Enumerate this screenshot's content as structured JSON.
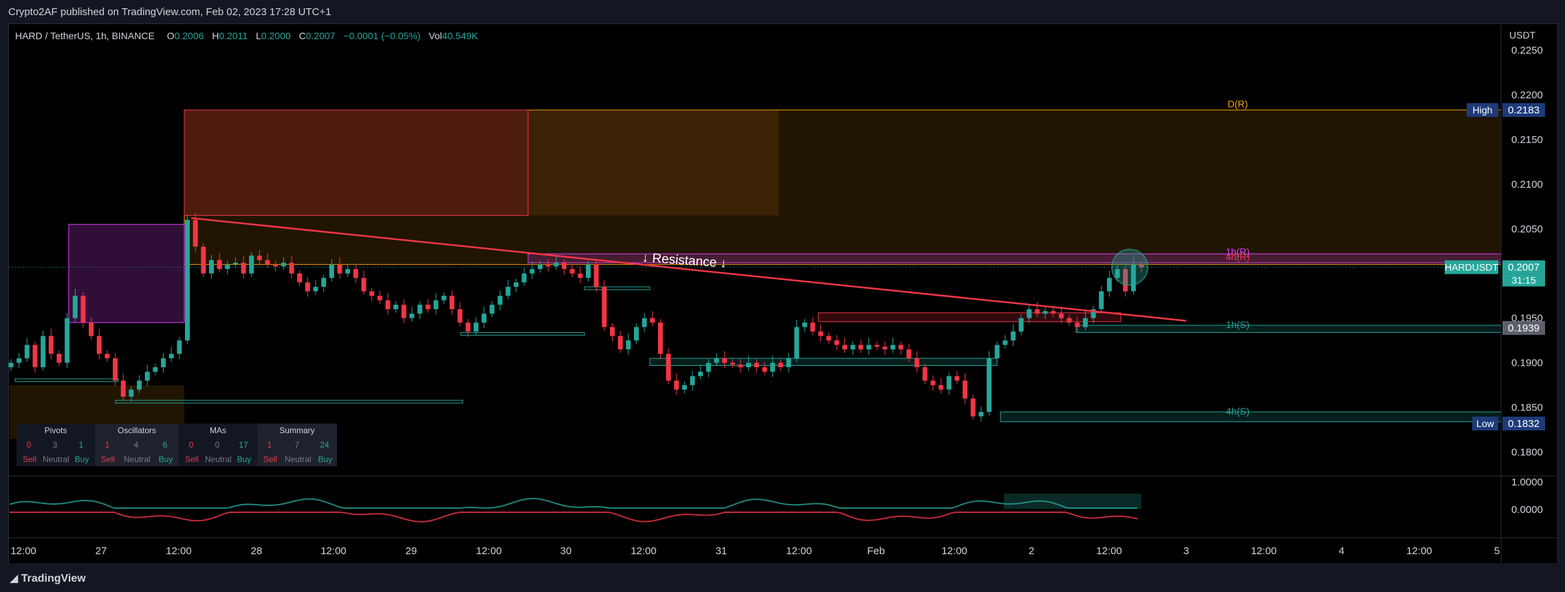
{
  "header": {
    "published": "Crypto2AF published on TradingView.com, Feb 02, 2023 17:28 UTC+1"
  },
  "legend": {
    "symbol": "HARD / TetherUS, 1h, BINANCE",
    "open_label": "O",
    "open": "0.2006",
    "high_label": "H",
    "high": "0.2011",
    "low_label": "L",
    "low": "0.2000",
    "close_label": "C",
    "close": "0.2007",
    "change": "−0.0001 (−0.05%)",
    "vol_label": "Vol",
    "vol": "40.549K"
  },
  "footer": {
    "brand": "TradingView"
  },
  "colors": {
    "up": "#26a69a",
    "down": "#f23645",
    "trendline": "#f23645",
    "zone_daily": "#f7a600",
    "zone_1h_r": "#e040fb",
    "support": "#26a69a"
  },
  "tech_summary": [
    {
      "title": "Pivots",
      "sell": "0",
      "neutral": "3",
      "buy": "1"
    },
    {
      "title": "Oscillators",
      "sell": "1",
      "neutral": "4",
      "buy": "6"
    },
    {
      "title": "MAs",
      "sell": "0",
      "neutral": "0",
      "buy": "17"
    },
    {
      "title": "Summary",
      "sell": "1",
      "neutral": "7",
      "buy": "24"
    }
  ],
  "tech_labels": {
    "sell": "Sell",
    "neutral": "Neutral",
    "buy": "Buy"
  },
  "chart_data": {
    "type": "candlestick",
    "title": "",
    "price_axis_unit": "USDT",
    "y_ticks": [
      "0.2250",
      "0.2200",
      "0.2150",
      "0.2100",
      "0.2050",
      "0.2000",
      "0.1950",
      "0.1900",
      "0.1850",
      "0.1800"
    ],
    "ylim": [
      0.1775,
      0.228
    ],
    "x_ticks": [
      "12:00",
      "27",
      "12:00",
      "28",
      "12:00",
      "29",
      "12:00",
      "30",
      "12:00",
      "31",
      "12:00",
      "Feb",
      "12:00",
      "2",
      "12:00",
      "3",
      "12:00",
      "4",
      "12:00",
      "5"
    ],
    "price_labels": [
      {
        "name": "High",
        "value": "0.2183"
      },
      {
        "name": "HARDUSDT",
        "value": "0.2007",
        "countdown": "31:15"
      },
      {
        "name": "",
        "value": "0.1939"
      },
      {
        "name": "Low",
        "value": "0.1832"
      }
    ],
    "zone_labels": {
      "daily_resistance": "D(R)",
      "h1_resistance": "1h(R)",
      "h4_resistance": "4h(R)",
      "h1_support": "1h(S)",
      "h4_support": "4h(S)"
    },
    "annotation": "↓ Resistance ↓",
    "zones": [
      {
        "label": "D(R)",
        "from": 0.2065,
        "to": 0.2183
      },
      {
        "label": "1h(R)",
        "from": 0.2012,
        "to": 0.2022
      },
      {
        "label": "1h(S)",
        "from": 0.1934,
        "to": 0.1942
      },
      {
        "label": "4h(S)",
        "from": 0.1834,
        "to": 0.1845
      }
    ],
    "series": [
      {
        "name": "HARDUSDT",
        "close": [
          0.19,
          0.1905,
          0.192,
          0.1895,
          0.193,
          0.191,
          0.19,
          0.195,
          0.1975,
          0.1945,
          0.193,
          0.191,
          0.1905,
          0.188,
          0.1862,
          0.187,
          0.188,
          0.189,
          0.1895,
          0.1905,
          0.191,
          0.1925,
          0.206,
          0.203,
          0.2,
          0.2015,
          0.2005,
          0.201,
          0.2012,
          0.2,
          0.202,
          0.2015,
          0.201,
          0.2008,
          0.2012,
          0.2,
          0.199,
          0.198,
          0.1985,
          0.1995,
          0.201,
          0.2,
          0.2005,
          0.1995,
          0.198,
          0.1975,
          0.197,
          0.196,
          0.1965,
          0.195,
          0.1955,
          0.1965,
          0.196,
          0.197,
          0.1975,
          0.196,
          0.1945,
          0.1935,
          0.1945,
          0.1955,
          0.1965,
          0.1975,
          0.1985,
          0.199,
          0.2,
          0.2005,
          0.201,
          0.2008,
          0.2012,
          0.2005,
          0.2,
          0.1995,
          0.201,
          0.1985,
          0.194,
          0.193,
          0.1915,
          0.1925,
          0.194,
          0.195,
          0.1945,
          0.191,
          0.188,
          0.187,
          0.1875,
          0.1885,
          0.189,
          0.19,
          0.1905,
          0.19,
          0.1898,
          0.1895,
          0.19,
          0.1895,
          0.189,
          0.19,
          0.1895,
          0.1905,
          0.194,
          0.1945,
          0.1935,
          0.193,
          0.1925,
          0.192,
          0.1915,
          0.192,
          0.1915,
          0.192,
          0.1918,
          0.1915,
          0.192,
          0.1915,
          0.1905,
          0.1895,
          0.188,
          0.1875,
          0.187,
          0.1885,
          0.188,
          0.186,
          0.184,
          0.1845,
          0.1905,
          0.192,
          0.1925,
          0.1935,
          0.195,
          0.196,
          0.1955,
          0.1958,
          0.1955,
          0.195,
          0.1945,
          0.194,
          0.195,
          0.196,
          0.198,
          0.1995,
          0.2005,
          0.198,
          0.201,
          0.2007
        ]
      }
    ]
  }
}
